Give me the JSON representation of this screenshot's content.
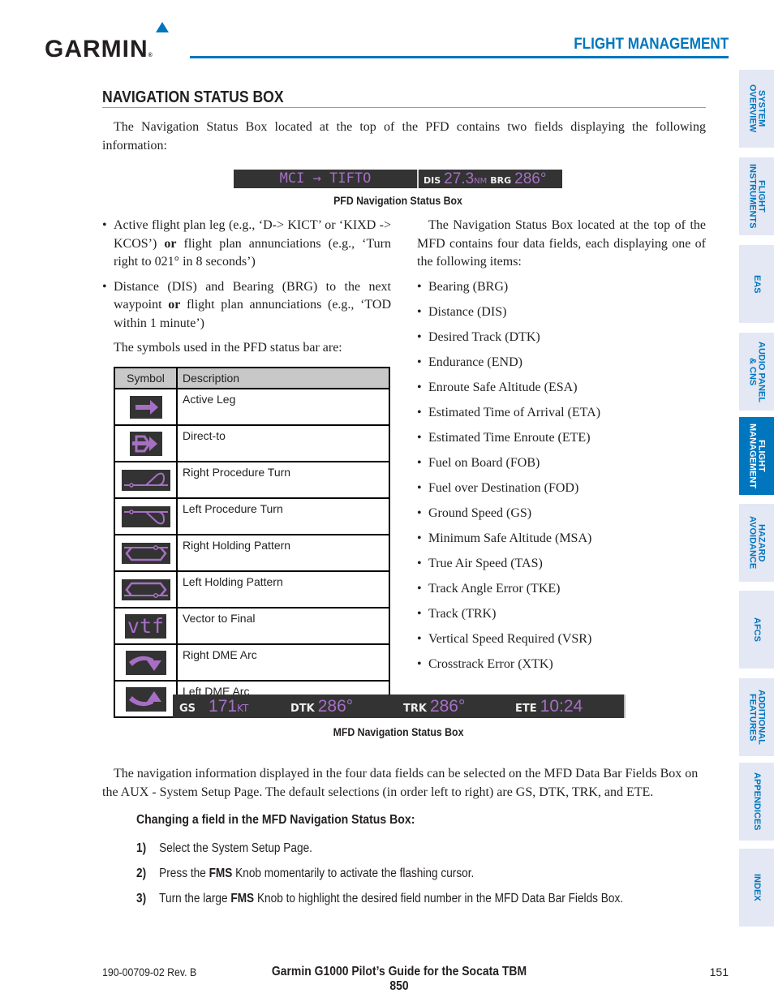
{
  "header": {
    "logo": "GARMIN",
    "section_title": "FLIGHT MANAGEMENT",
    "brand_color": "#0076be"
  },
  "page": {
    "heading": "NAVIGATION STATUS BOX",
    "intro": "The Navigation Status Box located at the top of the PFD contains two fields displaying the following information:"
  },
  "pfd_bar": {
    "leg_from": "MCI",
    "leg_arrow": "→",
    "leg_to": "TIFTO",
    "dis_label": "DIS",
    "dis_value": "27.3",
    "dis_unit": "NM",
    "brg_label": "BRG",
    "brg_value": "286°",
    "caption": "PFD Navigation Status Box",
    "value_color": "#a66fc4"
  },
  "left_column": {
    "bullets": [
      {
        "before": "Active flight plan leg (e.g., ‘D-> KICT’ or ‘KIXD -> KCOS’) ",
        "bold": "or",
        "after": " flight plan annunciations (e.g., ‘Turn right to 021° in 8 seconds’)"
      },
      {
        "before": "Distance (DIS) and Bearing (BRG) to the next waypoint ",
        "bold": "or",
        "after": " flight plan annunciations (e.g., ‘TOD within 1 minute’)"
      }
    ],
    "symbols_intro": "The symbols used in the PFD status bar are:"
  },
  "symbol_table": {
    "headers": [
      "Symbol",
      "Description"
    ],
    "rows": [
      {
        "icon": "active-leg-arrow",
        "description": "Active Leg"
      },
      {
        "icon": "direct-to",
        "description": "Direct-to"
      },
      {
        "icon": "right-procedure-turn",
        "description": "Right Procedure Turn"
      },
      {
        "icon": "left-procedure-turn",
        "description": "Left Procedure Turn"
      },
      {
        "icon": "right-holding-pattern",
        "description": "Right Holding Pattern"
      },
      {
        "icon": "left-holding-pattern",
        "description": "Left Holding Pattern"
      },
      {
        "icon": "vector-to-final",
        "description": "Vector to Final",
        "glyph": "vtf"
      },
      {
        "icon": "right-dme-arc",
        "description": "Right DME Arc"
      },
      {
        "icon": "left-dme-arc",
        "description": "Left DME Arc"
      }
    ]
  },
  "right_column": {
    "intro": "The Navigation Status Box located at the top of the MFD contains four data fields, each displaying one of the following items:",
    "items": [
      "Bearing (BRG)",
      "Distance (DIS)",
      "Desired Track (DTK)",
      "Endurance (END)",
      "Enroute Safe Altitude (ESA)",
      "Estimated Time of Arrival (ETA)",
      "Estimated Time Enroute (ETE)",
      "Fuel on Board (FOB)",
      "Fuel over Destination (FOD)",
      "Ground Speed (GS)",
      "Minimum Safe Altitude (MSA)",
      "True Air Speed (TAS)",
      "Track Angle Error (TKE)",
      "Track (TRK)",
      "Vertical Speed Required (VSR)",
      "Crosstrack Error (XTK)"
    ]
  },
  "mfd_bar": {
    "fields": [
      {
        "label": "GS",
        "value": "171",
        "unit": "KT"
      },
      {
        "label": "DTK",
        "value": "286°",
        "unit": ""
      },
      {
        "label": "TRK",
        "value": "286°",
        "unit": ""
      },
      {
        "label": "ETE",
        "value": "10:24",
        "unit": ""
      }
    ],
    "caption": "MFD Navigation Status Box"
  },
  "body": {
    "paragraph": "The navigation information displayed in the four data fields can be selected on the MFD Data Bar Fields Box on the AUX - System Setup Page.  The default selections (in order left to right) are GS, DTK, TRK, and ETE.",
    "procedure_title": "Changing a field in the MFD Navigation Status Box:",
    "steps": [
      {
        "num": "1)",
        "before": "Select the System Setup Page.",
        "bold": "",
        "after": ""
      },
      {
        "num": "2)",
        "before": "Press the ",
        "bold": "FMS",
        "after": " Knob momentarily to activate the flashing cursor."
      },
      {
        "num": "3)",
        "before": "Turn the large ",
        "bold": "FMS",
        "after": " Knob to highlight the desired field number in the MFD Data Bar Fields Box."
      }
    ]
  },
  "footer": {
    "doc_number": "190-00709-02  Rev. B",
    "title": "Garmin G1000 Pilot’s Guide for the Socata TBM 850",
    "page_number": "151"
  },
  "side_tabs": [
    {
      "label": "SYSTEM\nOVERVIEW",
      "active": false
    },
    {
      "label": "FLIGHT\nINSTRUMENTS",
      "active": false
    },
    {
      "label": "EAS",
      "active": false
    },
    {
      "label": "AUDIO PANEL\n& CNS",
      "active": false
    },
    {
      "label": "FLIGHT\nMANAGEMENT",
      "active": true
    },
    {
      "label": "HAZARD\nAVOIDANCE",
      "active": false
    },
    {
      "label": "AFCS",
      "active": false
    },
    {
      "label": "ADDITIONAL\nFEATURES",
      "active": false
    },
    {
      "label": "APPENDICES",
      "active": false
    },
    {
      "label": "INDEX",
      "active": false
    }
  ]
}
